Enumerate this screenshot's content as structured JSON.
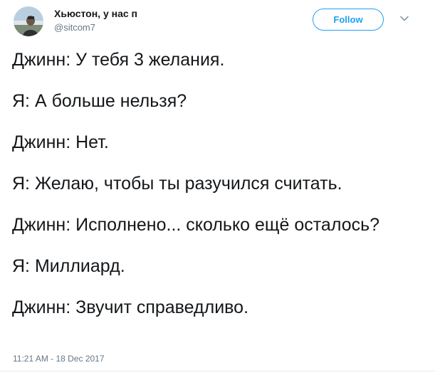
{
  "user": {
    "display_name": "Хьюстон, у нас п",
    "handle": "@sitcom7",
    "avatar_icon": "profile-photo-icon"
  },
  "actions": {
    "follow_label": "Follow",
    "menu_icon": "chevron-down-icon"
  },
  "tweet": {
    "lines": [
      "Джинн: У тебя 3 желания.",
      "Я: А больше нельзя?",
      "Джинн: Нет.",
      "Я: Желаю, чтобы ты разучился считать.",
      "Джинн: Исполнено... сколько ещё осталось?",
      "Я: Миллиард.",
      "Джинн: Звучит справедливо."
    ],
    "timestamp": "11:21 AM - 18 Dec 2017"
  },
  "colors": {
    "accent": "#1da1f2",
    "text": "#14171a",
    "secondary": "#657786"
  }
}
